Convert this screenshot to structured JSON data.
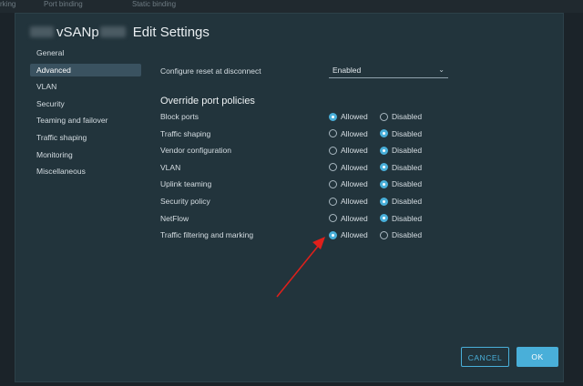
{
  "background": {
    "labels": [
      "rking",
      "Port binding",
      "Static binding"
    ]
  },
  "dialog": {
    "title_name": "vSANp",
    "title_text": "Edit Settings"
  },
  "nav": {
    "items": [
      {
        "label": "General"
      },
      {
        "label": "Advanced",
        "selected": true
      },
      {
        "label": "VLAN"
      },
      {
        "label": "Security"
      },
      {
        "label": "Teaming and failover"
      },
      {
        "label": "Traffic shaping"
      },
      {
        "label": "Monitoring"
      },
      {
        "label": "Miscellaneous"
      }
    ]
  },
  "settings": {
    "reset_label": "Configure reset at disconnect",
    "reset_value": "Enabled",
    "override_title": "Override port policies",
    "allowed_label": "Allowed",
    "disabled_label": "Disabled",
    "policies": [
      {
        "label": "Block ports",
        "selected": "Allowed"
      },
      {
        "label": "Traffic shaping",
        "selected": "Disabled"
      },
      {
        "label": "Vendor configuration",
        "selected": "Disabled"
      },
      {
        "label": "VLAN",
        "selected": "Disabled"
      },
      {
        "label": "Uplink teaming",
        "selected": "Disabled"
      },
      {
        "label": "Security policy",
        "selected": "Disabled"
      },
      {
        "label": "NetFlow",
        "selected": "Disabled"
      },
      {
        "label": "Traffic filtering and marking",
        "selected": "Allowed"
      }
    ]
  },
  "footer": {
    "cancel_label": "CANCEL",
    "ok_label": "OK"
  },
  "colors": {
    "accent": "#49afd9",
    "annotation": "#e0201b",
    "dialog_bg": "#22343c"
  }
}
